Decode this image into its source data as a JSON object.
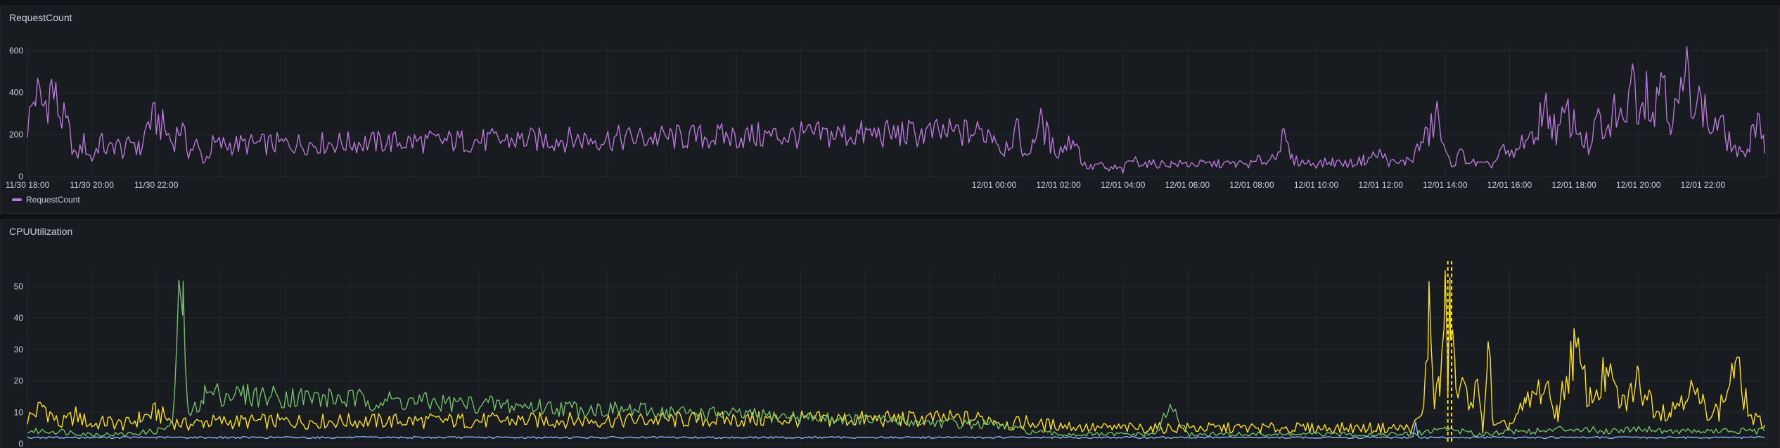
{
  "panels": {
    "requests": {
      "title": "RequestCount"
    },
    "cpu": {
      "title": "CPUUtilization"
    }
  },
  "chart_data": [
    {
      "type": "line",
      "title": "RequestCount",
      "x_range": [
        "11/30 18:00",
        "12/02 00:00"
      ],
      "ylim": [
        0,
        620
      ],
      "yticks": [
        0,
        200,
        400,
        600
      ],
      "xticks": [
        "11/30 18:00",
        "11/30 20:00",
        "11/30 22:00",
        "12/01 00:00",
        "12/01 02:00",
        "12/01 04:00",
        "12/01 06:00",
        "12/01 08:00",
        "12/01 10:00",
        "12/01 12:00",
        "12/01 14:00",
        "12/01 16:00",
        "12/01 18:00",
        "12/01 20:00",
        "12/01 22:00"
      ],
      "grid": true,
      "legend_position": "bottom-left",
      "series": [
        {
          "name": "RequestCount",
          "color": "#b877d9",
          "points": [
            [
              "11/30 18:00",
              240
            ],
            [
              "11/30 18:15",
              400
            ],
            [
              "11/30 18:30",
              330
            ],
            [
              "11/30 18:45",
              430
            ],
            [
              "11/30 19:00",
              300
            ],
            [
              "11/30 19:15",
              230
            ],
            [
              "11/30 19:30",
              90
            ],
            [
              "11/30 19:45",
              160
            ],
            [
              "11/30 20:00",
              80
            ],
            [
              "11/30 20:15",
              170
            ],
            [
              "11/30 20:30",
              120
            ],
            [
              "11/30 20:45",
              160
            ],
            [
              "11/30 21:00",
              110
            ],
            [
              "11/30 21:15",
              180
            ],
            [
              "11/30 21:30",
              120
            ],
            [
              "11/30 21:45",
              260
            ],
            [
              "11/30 22:00",
              270
            ],
            [
              "11/30 22:15",
              230
            ],
            [
              "11/30 22:30",
              160
            ],
            [
              "11/30 22:45",
              240
            ],
            [
              "11/30 23:00",
              120
            ],
            [
              "11/30 23:15",
              150
            ],
            [
              "11/30 23:30",
              70
            ],
            [
              "11/30 23:45",
              150
            ],
            [
              "12/01 00:00",
              210
            ],
            [
              "12/01 00:15",
              120
            ],
            [
              "12/01 00:30",
              180
            ],
            [
              "12/01 00:45",
              210
            ],
            [
              "12/01 01:00",
              80
            ],
            [
              "12/01 01:15",
              200
            ],
            [
              "12/01 01:30",
              260
            ],
            [
              "12/01 01:45",
              150
            ],
            [
              "12/01 02:00",
              120
            ],
            [
              "12/01 02:15",
              150
            ],
            [
              "12/01 02:30",
              190
            ],
            [
              "12/01 02:45",
              60
            ],
            [
              "12/01 03:00",
              40
            ],
            [
              "12/01 03:15",
              60
            ],
            [
              "12/01 03:30",
              30
            ],
            [
              "12/01 03:45",
              40
            ],
            [
              "12/01 04:00",
              30
            ],
            [
              "12/01 04:15",
              80
            ],
            [
              "12/01 04:30",
              70
            ],
            [
              "12/01 04:45",
              60
            ],
            [
              "12/01 05:00",
              60
            ],
            [
              "12/01 05:30",
              60
            ],
            [
              "12/01 06:00",
              60
            ],
            [
              "12/01 06:30",
              60
            ],
            [
              "12/01 07:00",
              60
            ],
            [
              "12/01 07:30",
              60
            ],
            [
              "12/01 08:00",
              60
            ],
            [
              "12/01 08:15",
              80
            ],
            [
              "12/01 08:30",
              70
            ],
            [
              "12/01 08:45",
              120
            ],
            [
              "12/01 09:00",
              180
            ],
            [
              "12/01 09:15",
              80
            ],
            [
              "12/01 09:30",
              70
            ],
            [
              "12/01 10:00",
              60
            ],
            [
              "12/01 10:30",
              70
            ],
            [
              "12/01 11:00",
              60
            ],
            [
              "12/01 11:30",
              80
            ],
            [
              "12/01 12:00",
              110
            ],
            [
              "12/01 12:15",
              70
            ],
            [
              "12/01 12:30",
              60
            ],
            [
              "12/01 12:45",
              70
            ],
            [
              "12/01 13:00",
              90
            ],
            [
              "12/01 13:15",
              160
            ],
            [
              "12/01 13:30",
              200
            ],
            [
              "12/01 13:45",
              300
            ],
            [
              "12/01 14:00",
              100
            ],
            [
              "12/01 14:15",
              60
            ],
            [
              "12/01 14:30",
              110
            ],
            [
              "12/01 14:45",
              70
            ],
            [
              "12/01 15:00",
              60
            ],
            [
              "12/01 15:15",
              50
            ],
            [
              "12/01 15:30",
              60
            ],
            [
              "12/01 15:45",
              130
            ],
            [
              "12/01 16:00",
              90
            ],
            [
              "12/01 16:15",
              120
            ],
            [
              "12/01 16:30",
              200
            ],
            [
              "12/01 16:45",
              150
            ],
            [
              "12/01 17:00",
              340
            ],
            [
              "12/01 17:15",
              280
            ],
            [
              "12/01 17:30",
              200
            ],
            [
              "12/01 17:45",
              300
            ],
            [
              "12/01 18:00",
              250
            ],
            [
              "12/01 18:15",
              200
            ],
            [
              "12/01 18:30",
              120
            ],
            [
              "12/01 18:45",
              280
            ],
            [
              "12/01 19:00",
              170
            ],
            [
              "12/01 19:15",
              330
            ],
            [
              "12/01 19:30",
              240
            ],
            [
              "12/01 19:45",
              500
            ],
            [
              "12/01 20:00",
              350
            ],
            [
              "12/01 20:15",
              440
            ],
            [
              "12/01 20:30",
              280
            ],
            [
              "12/01 20:45",
              560
            ],
            [
              "12/01 21:00",
              270
            ],
            [
              "12/01 21:15",
              330
            ],
            [
              "12/01 21:30",
              500
            ],
            [
              "12/01 21:45",
              380
            ],
            [
              "12/01 22:00",
              330
            ],
            [
              "12/01 22:15",
              220
            ],
            [
              "12/01 22:30",
              260
            ],
            [
              "12/01 22:45",
              180
            ],
            [
              "12/01 23:00",
              130
            ],
            [
              "12/01 23:15",
              90
            ],
            [
              "12/01 23:30",
              200
            ],
            [
              "12/01 23:45",
              320
            ],
            [
              "12/01 23:55",
              110
            ]
          ]
        }
      ]
    },
    {
      "type": "line",
      "title": "CPUUtilization",
      "x_range": [
        "11/30 18:00",
        "12/02 00:00"
      ],
      "ylim": [
        0,
        55
      ],
      "yticks": [
        0,
        10,
        20,
        30,
        40,
        50
      ],
      "grid": true,
      "markers": [
        {
          "time": "12/01 14:05",
          "color": "#fade2a",
          "style": "dashed"
        },
        {
          "time": "12/01 14:12",
          "color": "#fade2a",
          "style": "dashed"
        }
      ],
      "series": [
        {
          "color": "#fade2a",
          "points": [
            [
              "11/30 18:00",
              8
            ],
            [
              "11/30 18:30",
              12
            ],
            [
              "11/30 19:00",
              6
            ],
            [
              "11/30 19:30",
              9
            ],
            [
              "11/30 20:00",
              6
            ],
            [
              "11/30 20:30",
              7
            ],
            [
              "11/30 21:00",
              6
            ],
            [
              "11/30 21:30",
              8
            ],
            [
              "11/30 22:00",
              10
            ],
            [
              "11/30 22:30",
              7
            ],
            [
              "11/30 23:00",
              6
            ],
            [
              "11/30 23:30",
              7
            ],
            [
              "12/01 00:00",
              8
            ],
            [
              "12/01 00:30",
              6
            ],
            [
              "12/01 01:00",
              7
            ],
            [
              "12/01 01:30",
              6
            ],
            [
              "12/01 02:00",
              6
            ],
            [
              "12/01 03:00",
              5
            ],
            [
              "12/01 04:00",
              5
            ],
            [
              "12/01 05:00",
              5
            ],
            [
              "12/01 06:00",
              5
            ],
            [
              "12/01 07:00",
              5
            ],
            [
              "12/01 08:00",
              5
            ],
            [
              "12/01 09:00",
              5
            ],
            [
              "12/01 10:00",
              5
            ],
            [
              "12/01 11:00",
              5
            ],
            [
              "12/01 12:00",
              5
            ],
            [
              "12/01 13:00",
              5
            ],
            [
              "12/01 13:20",
              10
            ],
            [
              "12/01 13:30",
              42
            ],
            [
              "12/01 13:40",
              15
            ],
            [
              "12/01 13:50",
              18
            ],
            [
              "12/01 14:00",
              44
            ],
            [
              "12/01 14:05",
              20
            ],
            [
              "12/01 14:10",
              45
            ],
            [
              "12/01 14:20",
              17
            ],
            [
              "12/01 14:40",
              16
            ],
            [
              "12/01 15:00",
              16
            ],
            [
              "12/01 15:10",
              5
            ],
            [
              "12/01 15:20",
              32
            ],
            [
              "12/01 15:30",
              5
            ],
            [
              "12/01 16:00",
              6
            ],
            [
              "12/01 16:30",
              12
            ],
            [
              "12/01 17:00",
              18
            ],
            [
              "12/01 17:30",
              10
            ],
            [
              "12/01 18:00",
              30
            ],
            [
              "12/01 18:30",
              14
            ],
            [
              "12/01 19:00",
              22
            ],
            [
              "12/01 19:30",
              12
            ],
            [
              "12/01 20:00",
              20
            ],
            [
              "12/01 20:30",
              12
            ],
            [
              "12/01 21:00",
              10
            ],
            [
              "12/01 21:30",
              18
            ],
            [
              "12/01 22:00",
              12
            ],
            [
              "12/01 22:30",
              10
            ],
            [
              "12/01 23:00",
              25
            ],
            [
              "12/01 23:30",
              8
            ],
            [
              "12/01 23:55",
              6
            ]
          ]
        },
        {
          "color": "#73bf69",
          "points": [
            [
              "11/30 18:00",
              4
            ],
            [
              "11/30 19:00",
              4
            ],
            [
              "11/30 20:00",
              3
            ],
            [
              "11/30 21:00",
              3
            ],
            [
              "11/30 22:00",
              4
            ],
            [
              "11/30 22:30",
              6
            ],
            [
              "11/30 22:45",
              51
            ],
            [
              "11/30 22:50",
              43
            ],
            [
              "11/30 23:00",
              8
            ],
            [
              "11/30 23:30",
              16
            ],
            [
              "12/01 00:00",
              6
            ],
            [
              "12/01 01:00",
              4
            ],
            [
              "12/01 02:00",
              3
            ],
            [
              "12/01 03:00",
              3
            ],
            [
              "12/01 04:00",
              3
            ],
            [
              "12/01 05:00",
              3
            ],
            [
              "12/01 05:30",
              12
            ],
            [
              "12/01 06:00",
              3
            ],
            [
              "12/01 08:00",
              3
            ],
            [
              "12/01 10:00",
              3
            ],
            [
              "12/01 12:00",
              3
            ],
            [
              "12/01 13:00",
              3
            ],
            [
              "12/01 14:00",
              5
            ],
            [
              "12/01 15:00",
              3
            ],
            [
              "12/01 16:00",
              4
            ],
            [
              "12/01 17:00",
              4
            ],
            [
              "12/01 18:00",
              5
            ],
            [
              "12/01 19:00",
              4
            ],
            [
              "12/01 20:00",
              5
            ],
            [
              "12/01 21:00",
              4
            ],
            [
              "12/01 22:00",
              4
            ],
            [
              "12/01 23:00",
              4
            ],
            [
              "12/01 23:55",
              4
            ]
          ]
        },
        {
          "color": "#8ab8ff",
          "points": [
            [
              "11/30 18:00",
              2
            ],
            [
              "11/30 22:00",
              2
            ],
            [
              "12/01 02:00",
              2
            ],
            [
              "12/01 06:00",
              2
            ],
            [
              "12/01 10:00",
              2
            ],
            [
              "12/01 13:00",
              2
            ],
            [
              "12/01 13:05",
              7
            ],
            [
              "12/01 13:10",
              2
            ],
            [
              "12/01 16:00",
              2
            ],
            [
              "12/01 20:00",
              2
            ],
            [
              "12/01 23:55",
              2
            ]
          ]
        }
      ]
    }
  ]
}
